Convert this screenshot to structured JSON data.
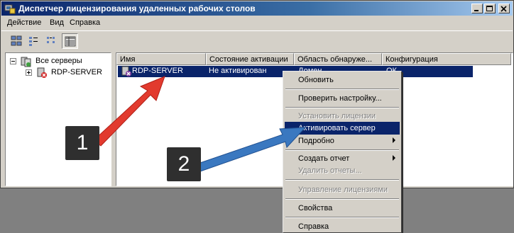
{
  "window": {
    "title": "Диспетчер лицензирования удаленных рабочих столов"
  },
  "menu": [
    "Действие",
    "Вид",
    "Справка"
  ],
  "toolbar": {
    "buttons": [
      "view-large-icons-icon",
      "view-small-icons-icon",
      "view-list-icon",
      "view-details-icon"
    ],
    "active": "view-details-icon"
  },
  "tree": {
    "root": "Все серверы",
    "child": "RDP-SERVER"
  },
  "list": {
    "columns": [
      "Имя",
      "Состояние активации",
      "Область обнаруже...",
      "Конфигурация"
    ],
    "rows": [
      {
        "name": "RDP-SERVER",
        "status": "Не активирован",
        "scope": "Домен",
        "config": "ОК"
      }
    ]
  },
  "context_menu": {
    "items": [
      {
        "label": "Обновить",
        "disabled": false
      },
      {
        "label": "Проверить настройку...",
        "disabled": false
      },
      {
        "label": "Установить лицензии",
        "disabled": true
      },
      {
        "label": "Активировать сервер",
        "disabled": false,
        "highlighted": true
      },
      {
        "label": "Подробно",
        "disabled": false,
        "submenu": true
      },
      {
        "label": "Создать отчет",
        "disabled": false,
        "submenu": true
      },
      {
        "label": "Удалить отчеты...",
        "disabled": true
      },
      {
        "label": "Управление лицензиями",
        "disabled": true
      },
      {
        "label": "Свойства",
        "disabled": false
      },
      {
        "label": "Справка",
        "disabled": false
      }
    ]
  },
  "callouts": [
    "1",
    "2"
  ],
  "colors": {
    "selection": "#0a246a",
    "arrow_red": "#e23a2e",
    "arrow_blue": "#3a78c0",
    "callout_bg": "#2f2f2f"
  }
}
